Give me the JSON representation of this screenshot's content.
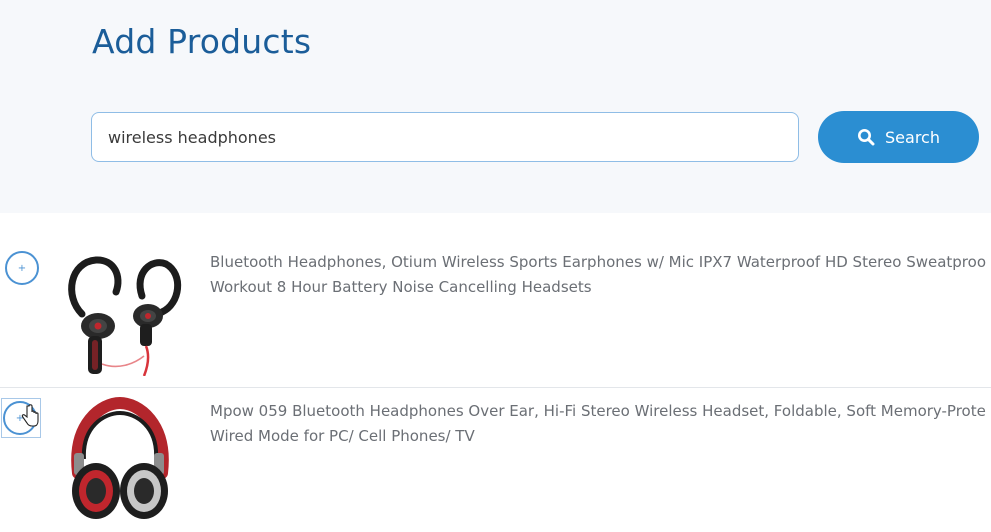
{
  "header": {
    "title": "Add Products"
  },
  "search": {
    "value": "wireless headphones",
    "button_label": "Search"
  },
  "products": [
    {
      "line1": "Bluetooth Headphones, Otium Wireless Sports Earphones w/ Mic IPX7 Waterproof HD Stereo Sweatproo",
      "line2": "Workout 8 Hour Battery Noise Cancelling Headsets",
      "add_icon": "plus-icon"
    },
    {
      "line1": "Mpow 059 Bluetooth Headphones Over Ear, Hi-Fi Stereo Wireless Headset, Foldable, Soft Memory-Prote",
      "line2": "Wired Mode for PC/ Cell Phones/ TV",
      "add_icon": "plus-icon"
    }
  ],
  "colors": {
    "accent": "#2b8ed2",
    "title": "#1b5d99",
    "text": "#6b6f75"
  }
}
